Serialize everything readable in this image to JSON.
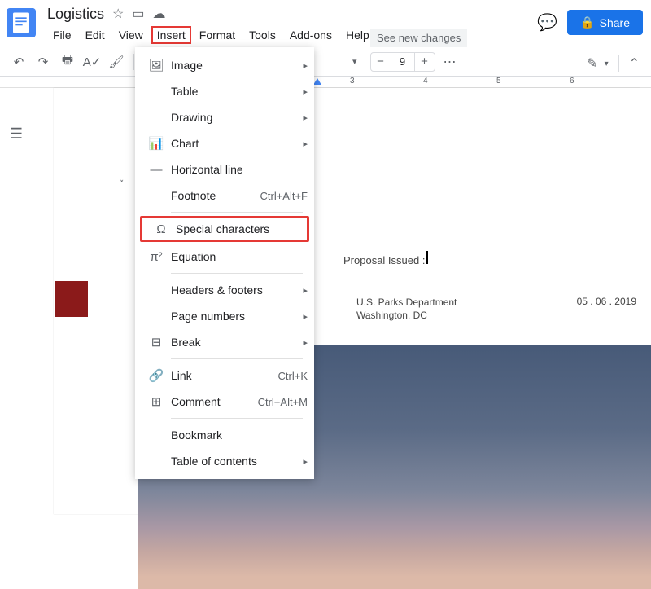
{
  "doc_title": "Logistics",
  "menus": {
    "file": "File",
    "edit": "Edit",
    "view": "View",
    "insert": "Insert",
    "format": "Format",
    "tools": "Tools",
    "addons": "Add-ons",
    "help": "Help"
  },
  "see_changes": "See new changes",
  "zoom": {
    "minus": "−",
    "plus": "+",
    "value": "9"
  },
  "share": "Share",
  "ruler": {
    "r3": "3",
    "r4": "4",
    "r5": "5",
    "r6": "6"
  },
  "dropdown": {
    "image": "Image",
    "table": "Table",
    "drawing": "Drawing",
    "chart": "Chart",
    "hr": "Horizontal line",
    "footnote": "Footnote",
    "footnote_sc": "Ctrl+Alt+F",
    "special": "Special characters",
    "equation": "Equation",
    "headers": "Headers & footers",
    "pagenum": "Page numbers",
    "break": "Break",
    "link": "Link",
    "link_sc": "Ctrl+K",
    "comment": "Comment",
    "comment_sc": "Ctrl+Alt+M",
    "bookmark": "Bookmark",
    "toc": "Table of contents"
  },
  "doc": {
    "proposal": "Proposal Issued :",
    "dept": "U.S. Parks Department",
    "city": "Washington, DC",
    "date": "05 . 06 . 2019"
  }
}
